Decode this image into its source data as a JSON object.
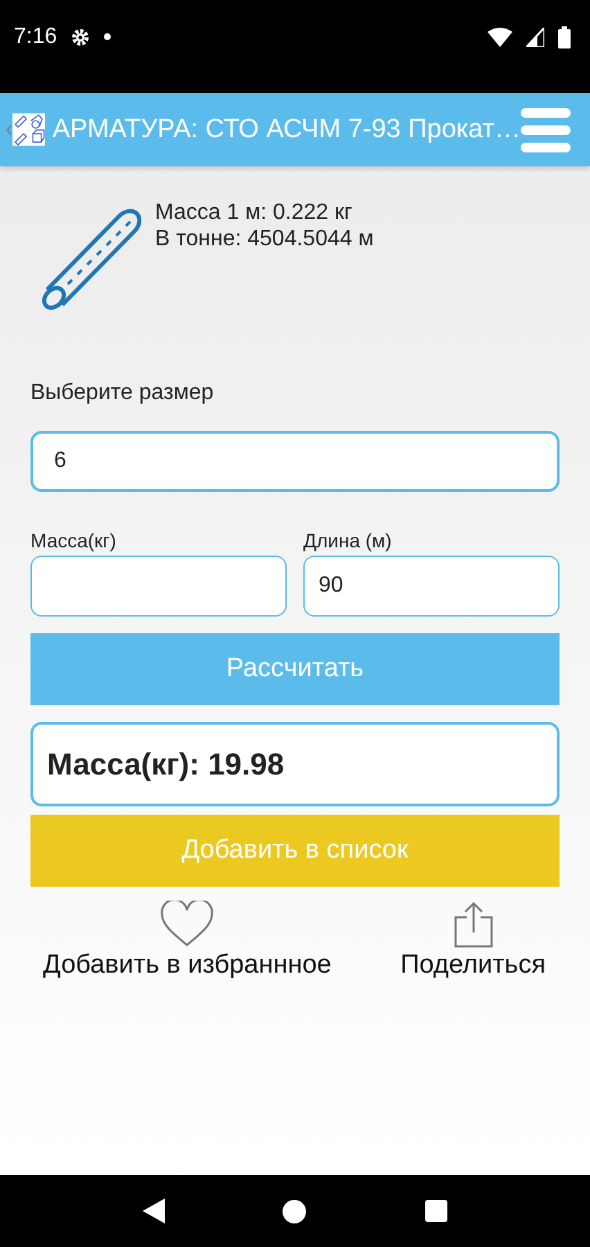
{
  "status_bar": {
    "time": "7:16"
  },
  "app_bar": {
    "title": "АРМАТУРА: СТО АСЧМ 7-93 Прокат…"
  },
  "info": {
    "lines": [
      "Масса 1 м: 0.222 кг",
      "В тонне: 4504.5044 м"
    ]
  },
  "size": {
    "label": "Выберите размер",
    "value": "6"
  },
  "fields": [
    {
      "label": "Масса(кг)"
    },
    {
      "label": "Длина (м)",
      "value": "90"
    }
  ],
  "calculate_button": "Рассчитать",
  "result": "Масса(кг): 19.98",
  "add_button": "Добавить в список",
  "actions": [
    {
      "kind": "favorite",
      "label": "Добавить в избраннное"
    },
    {
      "kind": "share",
      "label": "Поделиться"
    }
  ]
}
